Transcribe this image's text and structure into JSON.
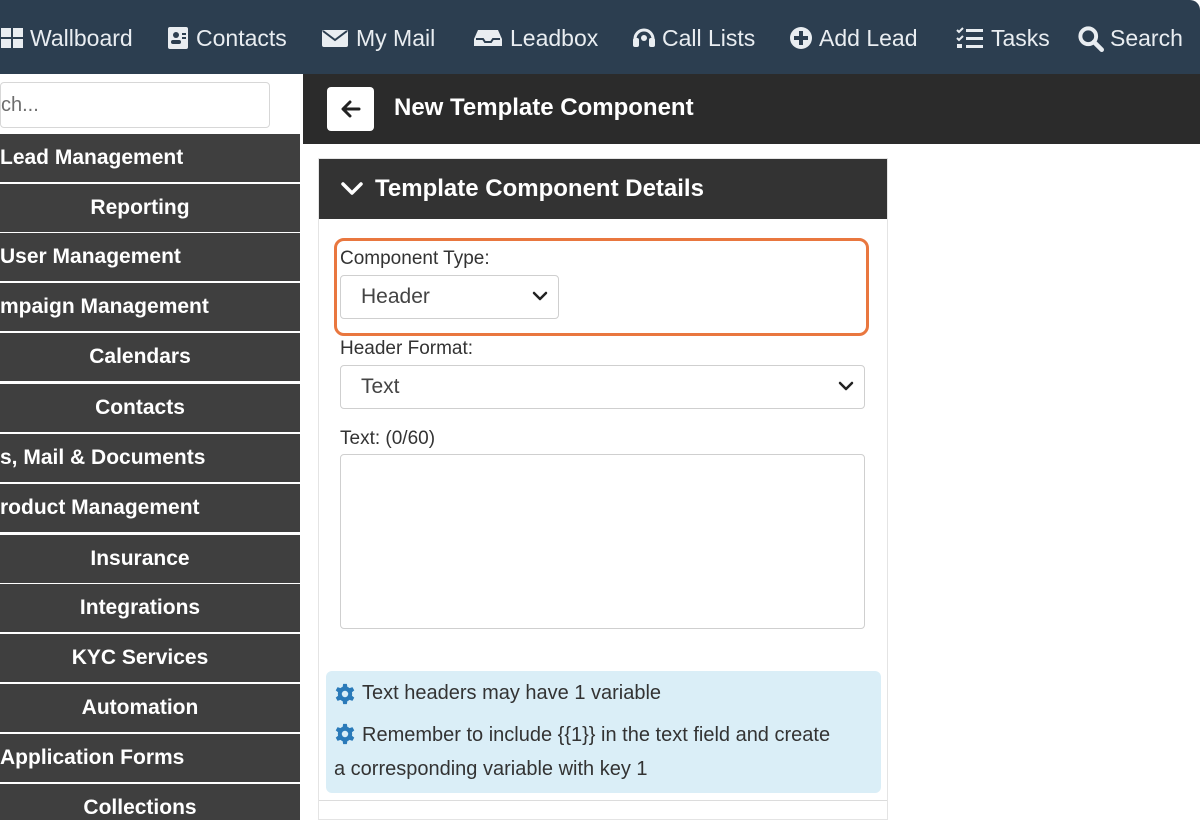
{
  "nav": {
    "items": [
      {
        "label": "Wallboard",
        "icon": "windows-icon"
      },
      {
        "label": "Contacts",
        "icon": "contact-card-icon"
      },
      {
        "label": "My Mail",
        "icon": "envelope-icon"
      },
      {
        "label": "Leadbox",
        "icon": "inbox-icon"
      },
      {
        "label": "Call Lists",
        "icon": "headset-icon"
      },
      {
        "label": "Add Lead",
        "icon": "plus-circle-icon"
      },
      {
        "label": "Tasks",
        "icon": "tasks-icon"
      },
      {
        "label": "Search",
        "icon": "search-icon"
      }
    ]
  },
  "sidebar": {
    "search_placeholder": "ch...",
    "items": [
      {
        "label": "Lead Management"
      },
      {
        "label": "Reporting"
      },
      {
        "label": "User Management"
      },
      {
        "label": "mpaign Management"
      },
      {
        "label": "Calendars"
      },
      {
        "label": "Contacts"
      },
      {
        "label": "s, Mail & Documents"
      },
      {
        "label": "roduct Management"
      },
      {
        "label": "Insurance"
      },
      {
        "label": "Integrations"
      },
      {
        "label": "KYC Services"
      },
      {
        "label": "Automation"
      },
      {
        "label": "Application Forms"
      },
      {
        "label": "Collections"
      }
    ]
  },
  "header": {
    "title": "New Template Component"
  },
  "panel": {
    "title": "Template Component Details",
    "component_type_label": "Component Type:",
    "component_type_value": "Header",
    "header_format_label": "Header Format:",
    "header_format_value": "Text",
    "text_label": "Text: (0/60)",
    "text_value": ""
  },
  "info": {
    "line1": "Text headers may have 1 variable",
    "line2": "Remember to include {{1}} in the text field and create a corresponding variable with key 1"
  },
  "colors": {
    "nav_bg": "#2c3e50",
    "sidebar_item_bg": "#3f3f3f",
    "highlight": "#e9773f",
    "info_bg": "#daeef7",
    "info_icon": "#2a7ab9"
  }
}
